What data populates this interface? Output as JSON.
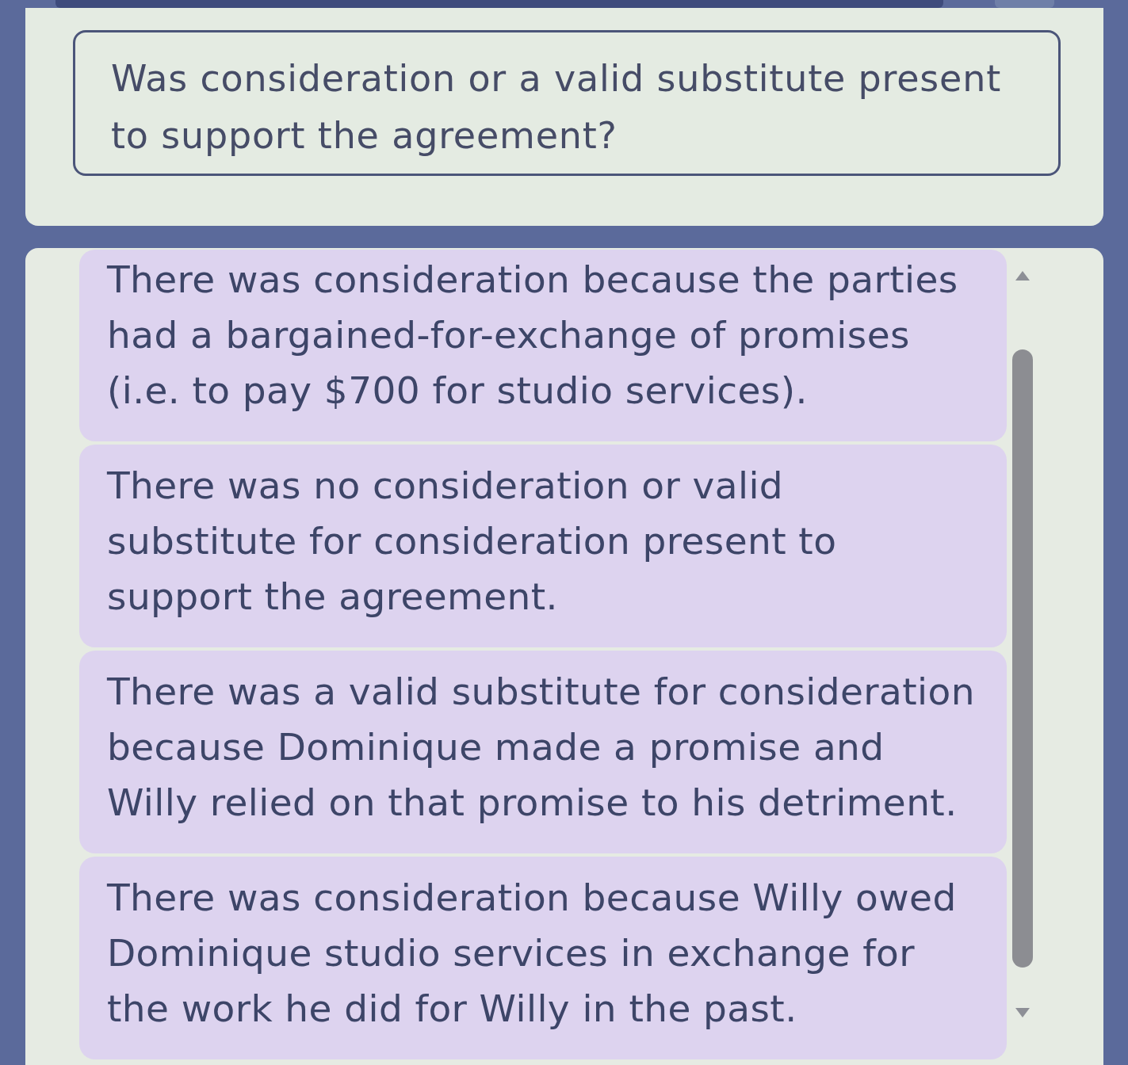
{
  "question": {
    "text": "Was consideration or a valid substitute present to support the agreement?"
  },
  "options": [
    {
      "text": "There was consideration because the parties had a bargained-for-exchange of promises (i.e. to pay $700 for studio services).",
      "selected": false
    },
    {
      "text": "There was no consideration or valid substitute for consideration present to support the agreement.",
      "selected": false
    },
    {
      "text": "There was a valid substitute for consideration because Dominique made a promise and Willy relied on that promise to his detriment.",
      "selected": false
    },
    {
      "text": "There was consideration because Willy owed Dominique studio services in exchange for the work he did for Willy in the past.",
      "selected": false
    }
  ]
}
